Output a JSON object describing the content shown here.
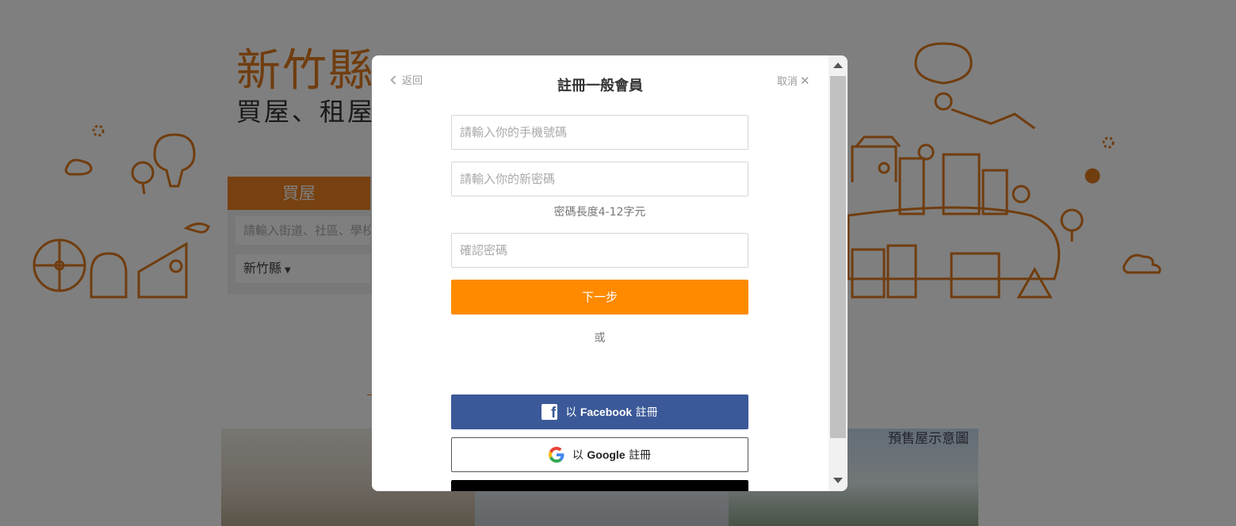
{
  "background": {
    "hero_title": "新竹縣",
    "hero_subtitle": "買屋、租屋",
    "search_tab": "買屋",
    "search_placeholder": "請輸入街道、社區、學校",
    "county": "新竹縣",
    "photo_caption": "預售屋示意圖"
  },
  "modal": {
    "back_label": "返回",
    "title": "註冊一般會員",
    "cancel_label": "取消",
    "phone_placeholder": "請輸入你的手機號碼",
    "password_placeholder": "請輸入你的新密碼",
    "password_hint": "密碼長度4-12字元",
    "confirm_placeholder": "確認密碼",
    "next_label": "下一步",
    "or_label": "或",
    "facebook_prefix": "以",
    "facebook_brand": "Facebook",
    "facebook_suffix": "註冊",
    "google_prefix": "以",
    "google_brand": "Google",
    "google_suffix": "註冊"
  },
  "colors": {
    "accent": "#ff8a00",
    "brand_orange": "#e07b1f",
    "facebook": "#3b5998",
    "overlay": "rgba(0,0,0,0.5)"
  },
  "icons": [
    "chevron-left-icon",
    "close-icon",
    "facebook-icon",
    "google-icon",
    "scroll-up-arrow",
    "scroll-down-arrow"
  ]
}
